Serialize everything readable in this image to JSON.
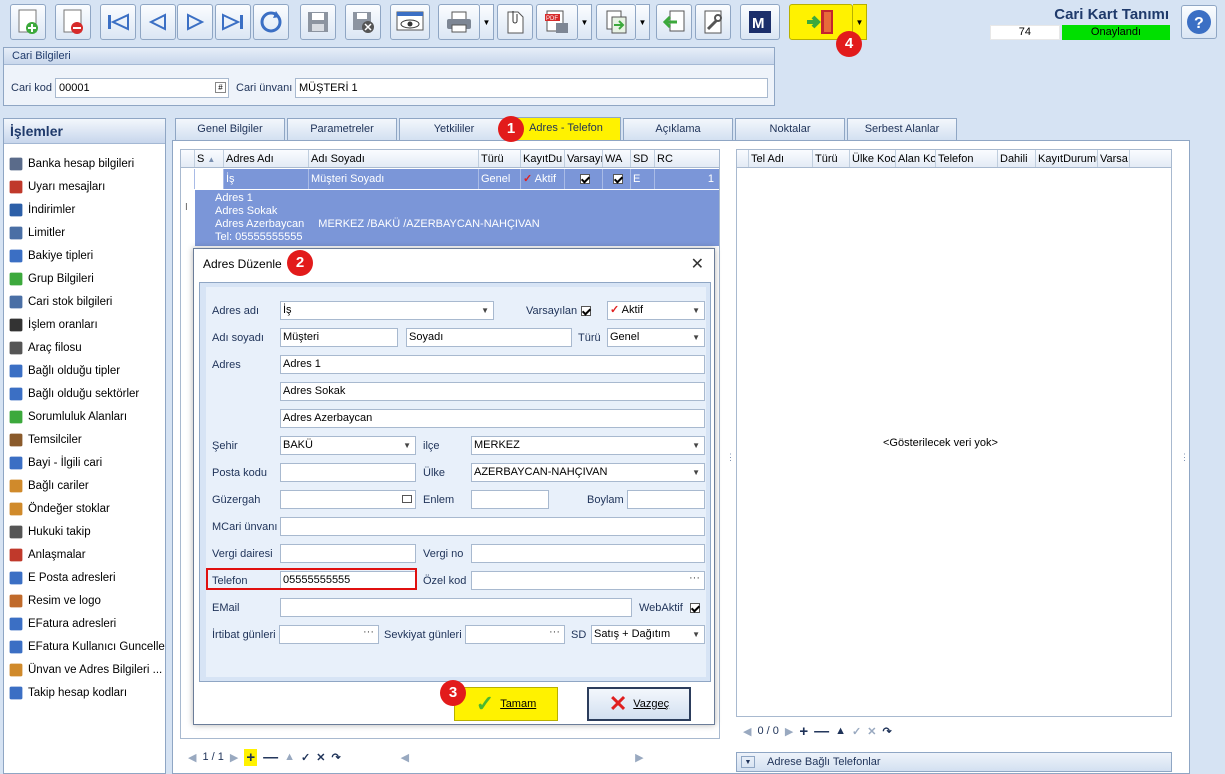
{
  "header": {
    "title": "Cari Kart Tanımı",
    "count": "74",
    "status": "Onaylandı",
    "status_color": "#00e000"
  },
  "toolbar": {
    "icons": [
      "new-icon",
      "delete-icon",
      "first-icon",
      "prev-icon",
      "next-icon",
      "last-icon",
      "refresh-icon",
      "save-icon",
      "save-close-icon",
      "preview-icon",
      "print-icon",
      "attach-icon",
      "pdf-icon",
      "export-icon",
      "import-icon",
      "tools-icon",
      "m-icon",
      "exit-icon"
    ],
    "accent": "#fff200"
  },
  "cari": {
    "group_title": "Cari Bilgileri",
    "kod_label": "Cari kod",
    "kod_value": "00001",
    "unvan_label": "Cari ünvanı",
    "unvan_value": "MÜŞTERİ 1"
  },
  "left": {
    "title": "İşlemler",
    "items": [
      "Banka hesap bilgileri",
      "Uyarı mesajları",
      "İndirimler",
      "Limitler",
      "Bakiye tipleri",
      "Grup Bilgileri",
      "Cari stok bilgileri",
      "İşlem oranları",
      "Araç filosu",
      "Bağlı olduğu tipler",
      "Bağlı olduğu sektörler",
      "Sorumluluk Alanları",
      "Temsilciler",
      "Bayi - İlgili cari",
      "Bağlı cariler",
      "Öndeğer stoklar",
      "Hukuki takip",
      "Anlaşmalar",
      "E Posta adresleri",
      "Resim ve logo",
      "EFatura adresleri",
      "EFatura Kullanıcı Guncelle",
      "Ünvan ve Adres Bilgileri ...",
      "Takip hesap kodları"
    ]
  },
  "tabs": [
    "Genel Bilgiler",
    "Parametreler",
    "Yetkililer",
    "Adres - Telefon",
    "Açıklama",
    "Noktalar",
    "Serbest Alanlar"
  ],
  "grid": {
    "columns": [
      "S",
      "Adres Adı",
      "Adı Soyadı",
      "Türü",
      "KayıtDu",
      "Varsayı",
      "WA",
      "SD",
      "RC"
    ],
    "row": {
      "adres": "İş",
      "adi": "Müşteri Soyadı",
      "turu": "Genel",
      "kayit": "Aktif",
      "sd": "E",
      "rc": "1"
    },
    "detail": [
      "Adres 1",
      "Adres Sokak",
      "Adres Azerbaycan",
      "MERKEZ /BAKÜ /AZERBAYCAN-NAHÇIVAN",
      "Tel: 05555555555"
    ],
    "pager": "1 / 1"
  },
  "phones": {
    "columns": [
      "Tel Adı",
      "Türü",
      "Ülke Koc",
      "Alan Ko",
      "Telefon",
      "Dahili",
      "KayıtDurumu",
      "Varsa"
    ],
    "empty": "<Gösterilecek veri yok>",
    "pager": "0 / 0",
    "footer": "Adrese Bağlı Telefonlar"
  },
  "dialog": {
    "title": "Adres Düzenle",
    "adres_adi_label": "Adres adı",
    "adres_adi": "İş",
    "varsayilan_label": "Varsayılan",
    "kayit_durumu": "Aktif",
    "adi_soyadi_label": "Adı soyadı",
    "adi": "Müşteri",
    "soyadi": "Soyadı",
    "turu_label": "Türü",
    "turu": "Genel",
    "adres_label": "Adres",
    "adres1": "Adres 1",
    "adres2": "Adres Sokak",
    "adres3": "Adres Azerbaycan",
    "sehir_label": "Şehir",
    "sehir": "BAKÜ",
    "ilce_label": "ilçe",
    "ilce": "MERKEZ",
    "posta_label": "Posta kodu",
    "ulke_label": "Ülke",
    "ulke": "AZERBAYCAN-NAHÇIVAN",
    "guzergah_label": "Güzergah",
    "enlem_label": "Enlem",
    "boylam_label": "Boylam",
    "mcari_label": "MCari ünvanı",
    "vergi_dairesi_label": "Vergi dairesi",
    "vergi_no_label": "Vergi no",
    "telefon_label": "Telefon",
    "telefon": "05555555555",
    "ozel_kod_label": "Özel kod",
    "email_label": "EMail",
    "webaktif_label": "WebAktif",
    "irtibat_label": "İrtibat günleri",
    "sevkiyat_label": "Sevkiyat günleri",
    "sd_label": "SD",
    "sd": "Satış + Dağıtım",
    "ok": "Tamam",
    "cancel": "Vazgeç"
  },
  "badges": [
    "1",
    "2",
    "3",
    "4"
  ]
}
